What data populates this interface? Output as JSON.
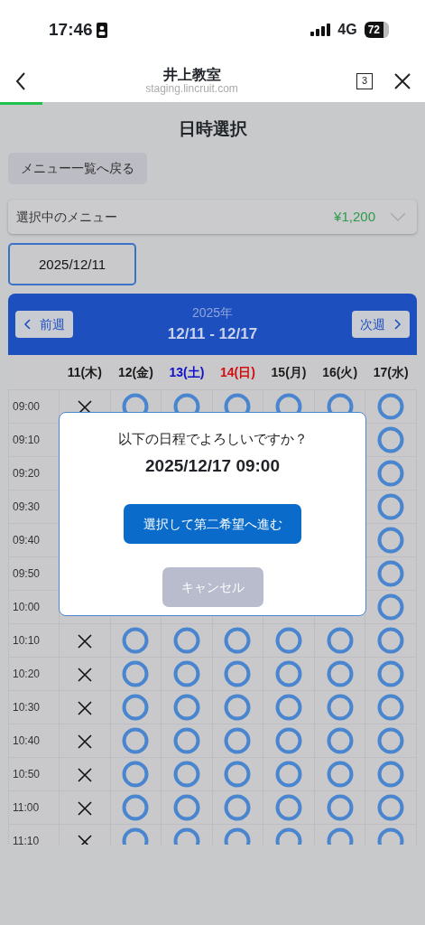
{
  "status_bar": {
    "time": "17:46",
    "network": "4G",
    "battery": "72"
  },
  "browser_bar": {
    "title": "井上教室",
    "url": "staging.lincruit.com",
    "tab_count": "3",
    "load_progress": {
      "level": 0.1
    }
  },
  "page": {
    "title": "日時選択",
    "back_button": "メニュー一覧へ戻る",
    "selected_menu": {
      "label": "選択中のメニュー",
      "price": "¥1,200",
      "expanded": false
    },
    "date_field": {
      "value": "2025/12/11"
    },
    "calendar": {
      "prev_button": "前週",
      "next_button": "次週",
      "year": "2025年",
      "range": "12/11 - 12/17",
      "days": [
        {
          "label": "11(木)",
          "color": "#1a1a1a"
        },
        {
          "label": "12(金)",
          "color": "#1a1a1a"
        },
        {
          "label": "13(土)",
          "color": "#1010c8"
        },
        {
          "label": "14(日)",
          "color": "#d01010"
        },
        {
          "label": "15(月)",
          "color": "#1a1a1a"
        },
        {
          "label": "16(火)",
          "color": "#1a1a1a"
        },
        {
          "label": "17(水)",
          "color": "#1a1a1a"
        }
      ],
      "rows": [
        {
          "time": "09:00",
          "slots": [
            {
              "available": false
            },
            {
              "available": true
            },
            {
              "available": true
            },
            {
              "available": true
            },
            {
              "available": true
            },
            {
              "available": true
            },
            {
              "available": true
            }
          ]
        },
        {
          "time": "09:10",
          "slots": [
            {
              "available": true
            }
          ]
        },
        {
          "time": "09:20",
          "slots": [
            {
              "available": true
            }
          ]
        },
        {
          "time": "09:30",
          "slots": [
            {
              "available": true
            }
          ]
        },
        {
          "time": "09:40",
          "slots": [
            {
              "available": true
            }
          ]
        },
        {
          "time": "09:50",
          "slots": [
            {
              "available": true
            }
          ]
        },
        {
          "time": "10:00",
          "slots": [
            {
              "available": true
            }
          ]
        },
        {
          "time": "10:10",
          "slots": [
            {
              "available": false
            },
            {
              "available": true
            },
            {
              "available": true
            },
            {
              "available": true
            },
            {
              "available": true
            },
            {
              "available": true
            },
            {
              "available": true
            }
          ]
        },
        {
          "time": "10:20",
          "slots": [
            {
              "available": false
            },
            {
              "available": true
            },
            {
              "available": true
            },
            {
              "available": true
            },
            {
              "available": true
            },
            {
              "available": true
            },
            {
              "available": true
            }
          ]
        },
        {
          "time": "10:30",
          "slots": [
            {
              "available": false
            },
            {
              "available": true
            },
            {
              "available": true
            },
            {
              "available": true
            },
            {
              "available": true
            },
            {
              "available": true
            },
            {
              "available": true
            }
          ]
        },
        {
          "time": "10:40",
          "slots": [
            {
              "available": false
            },
            {
              "available": true
            },
            {
              "available": true
            },
            {
              "available": true
            },
            {
              "available": true
            },
            {
              "available": true
            },
            {
              "available": true
            }
          ]
        },
        {
          "time": "10:50",
          "slots": [
            {
              "available": false
            },
            {
              "available": true
            },
            {
              "available": true
            },
            {
              "available": true
            },
            {
              "available": true
            },
            {
              "available": true
            },
            {
              "available": true
            }
          ]
        },
        {
          "time": "11:00",
          "slots": [
            {
              "available": false
            },
            {
              "available": true
            },
            {
              "available": true
            },
            {
              "available": true
            },
            {
              "available": true
            },
            {
              "available": true
            },
            {
              "available": true
            }
          ]
        },
        {
          "time": "11:10",
          "slots": [
            {
              "available": false
            },
            {
              "available": true
            },
            {
              "available": true
            },
            {
              "available": true
            },
            {
              "available": true
            },
            {
              "available": true
            },
            {
              "available": true
            }
          ]
        }
      ]
    }
  },
  "dialog": {
    "message": "以下の日程でよろしいですか？",
    "datetime": "2025/12/17 09:00",
    "confirm_button": "選択して第二希望へ進む",
    "cancel_button": "キャンセル"
  }
}
